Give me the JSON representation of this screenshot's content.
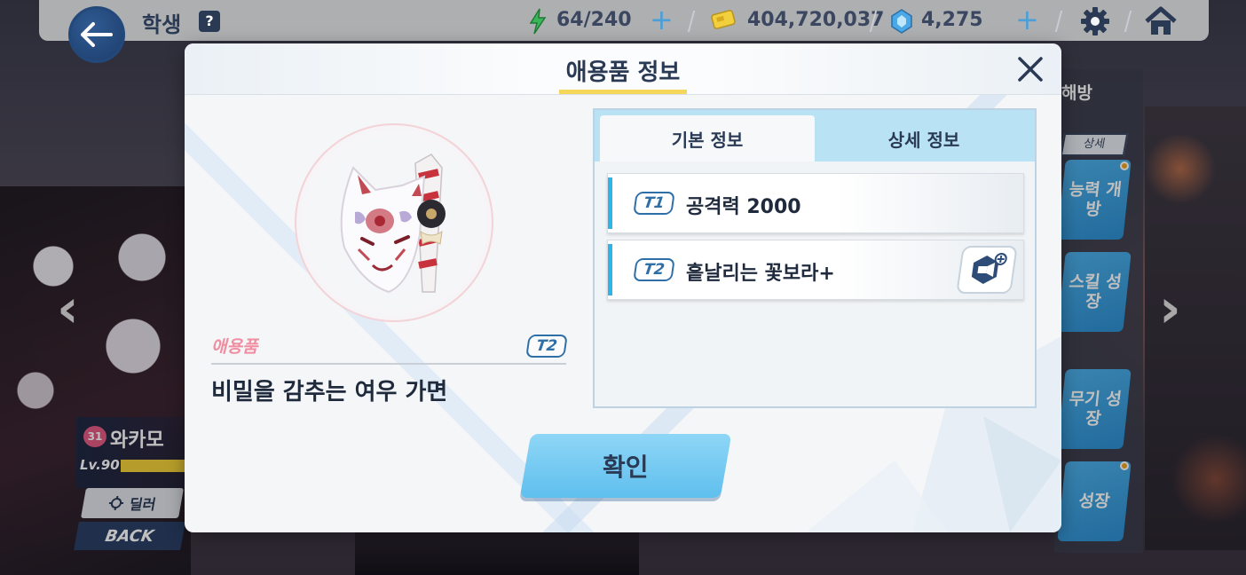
{
  "header": {
    "title": "학생",
    "help_label": "?",
    "ap": "64/240",
    "credits": "404,720,037",
    "pyroxene": "4,275",
    "ap_plus": "+",
    "pyroxene_plus": "+"
  },
  "side_menu": {
    "top_label": "해방",
    "detail_label": "상세",
    "buttons": [
      "능력 개방",
      "스킬 성장",
      "무기 성장",
      "성장"
    ]
  },
  "character": {
    "bond_level": "31",
    "name": "와카모",
    "level": "Lv.90",
    "level_fill_fraction": 0.9,
    "role": "딜러",
    "back_label": "BACK"
  },
  "modal": {
    "title": "애용품 정보",
    "close_icon": "close-icon",
    "item": {
      "type_label": "애용품",
      "tier": "T2",
      "name": "비밀을 감추는 여우 가면"
    },
    "tabs": [
      "기본 정보",
      "상세 정보"
    ],
    "stats": [
      {
        "tier": "T1",
        "text": "공격력 2000"
      },
      {
        "tier": "T2",
        "text": "흩날리는 꽃보라+"
      }
    ],
    "confirm_label": "확인"
  },
  "colors": {
    "accent": "#5fbfee",
    "title_underline": "#f3d65a",
    "item_type": "#f08da0",
    "tier_border": "#2f6fa8"
  }
}
